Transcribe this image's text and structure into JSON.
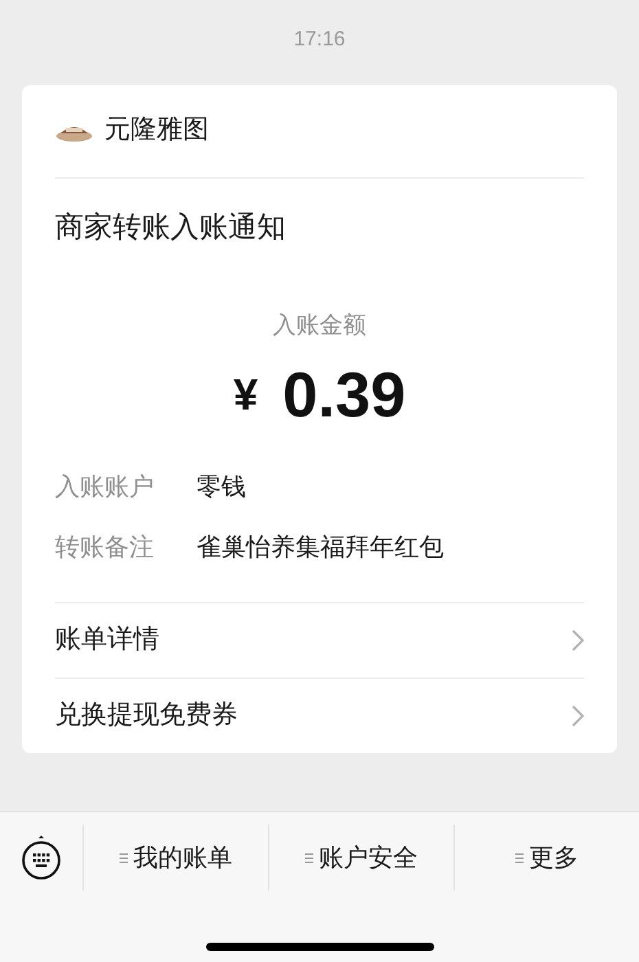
{
  "time": "17:16",
  "card": {
    "merchant": "元隆雅图",
    "title": "商家转账入账通知",
    "amount_label": "入账金额",
    "currency": "¥",
    "amount": "0.39",
    "details": [
      {
        "label": "入账账户",
        "value": "零钱"
      },
      {
        "label": "转账备注",
        "value": "雀巢怡养集福拜年红包"
      }
    ],
    "links": [
      {
        "label": "账单详情"
      },
      {
        "label": "兑换提现免费券"
      }
    ]
  },
  "menu": [
    {
      "label": "我的账单"
    },
    {
      "label": "账户安全"
    },
    {
      "label": "更多"
    }
  ]
}
